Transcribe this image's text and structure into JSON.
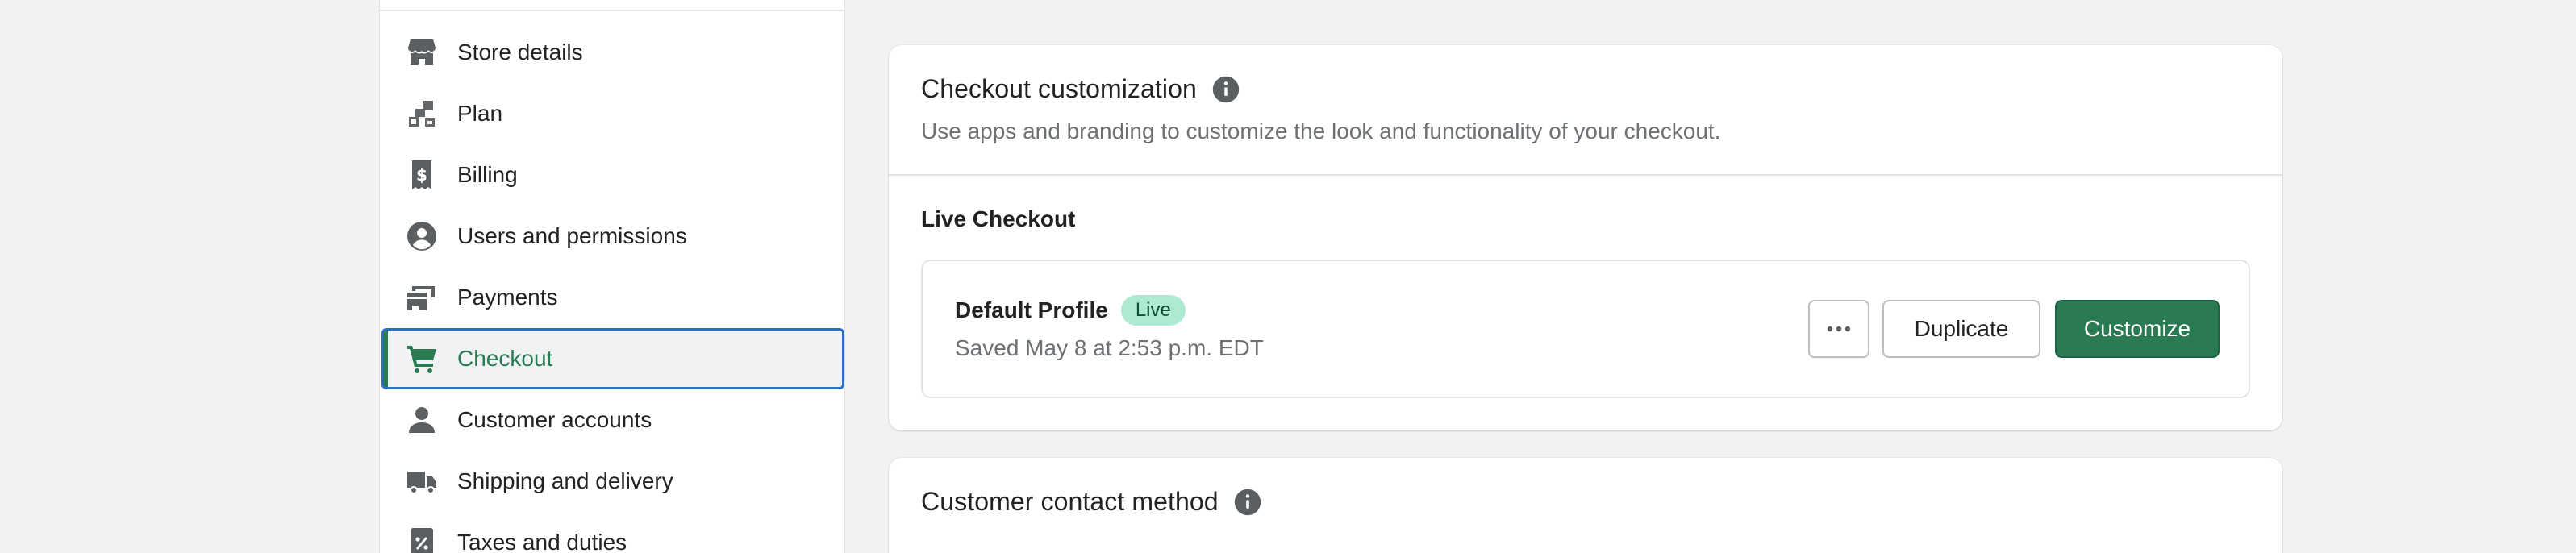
{
  "sidebar": {
    "items": [
      {
        "label": "Store details",
        "icon": "store-icon"
      },
      {
        "label": "Plan",
        "icon": "plan-icon"
      },
      {
        "label": "Billing",
        "icon": "billing-icon"
      },
      {
        "label": "Users and permissions",
        "icon": "user-circle-icon"
      },
      {
        "label": "Payments",
        "icon": "payments-icon"
      },
      {
        "label": "Checkout",
        "icon": "cart-icon",
        "active": true
      },
      {
        "label": "Customer accounts",
        "icon": "person-icon"
      },
      {
        "label": "Shipping and delivery",
        "icon": "truck-icon"
      },
      {
        "label": "Taxes and duties",
        "icon": "tax-icon"
      }
    ]
  },
  "checkout_customization": {
    "title": "Checkout customization",
    "subtitle": "Use apps and branding to customize the look and functionality of your checkout.",
    "section_title": "Live Checkout",
    "profile": {
      "name": "Default Profile",
      "badge": "Live",
      "saved": "Saved May 8 at 2:53 p.m. EDT"
    },
    "buttons": {
      "more": "•••",
      "duplicate": "Duplicate",
      "customize": "Customize"
    }
  },
  "customer_contact": {
    "title": "Customer contact method"
  },
  "colors": {
    "accent_green": "#2a7a52",
    "focus_blue": "#2c6ecb",
    "badge_bg": "#aee9d1",
    "background": "#f1f2f4"
  }
}
